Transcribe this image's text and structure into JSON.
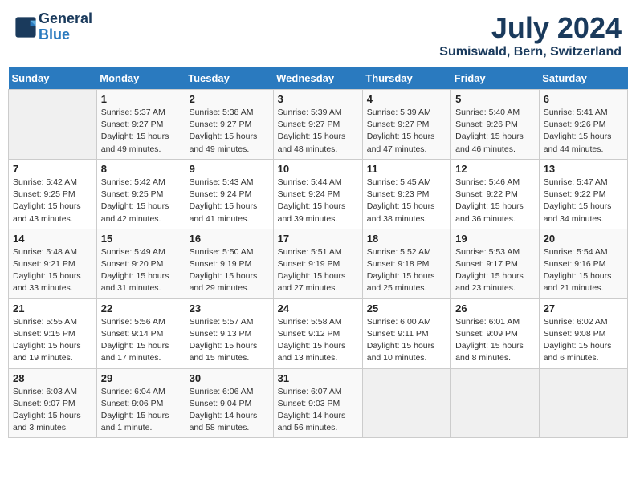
{
  "header": {
    "logo_line1": "General",
    "logo_line2": "Blue",
    "month_year": "July 2024",
    "location": "Sumiswald, Bern, Switzerland"
  },
  "days_of_week": [
    "Sunday",
    "Monday",
    "Tuesday",
    "Wednesday",
    "Thursday",
    "Friday",
    "Saturday"
  ],
  "weeks": [
    [
      {
        "day": "",
        "info": ""
      },
      {
        "day": "1",
        "info": "Sunrise: 5:37 AM\nSunset: 9:27 PM\nDaylight: 15 hours\nand 49 minutes."
      },
      {
        "day": "2",
        "info": "Sunrise: 5:38 AM\nSunset: 9:27 PM\nDaylight: 15 hours\nand 49 minutes."
      },
      {
        "day": "3",
        "info": "Sunrise: 5:39 AM\nSunset: 9:27 PM\nDaylight: 15 hours\nand 48 minutes."
      },
      {
        "day": "4",
        "info": "Sunrise: 5:39 AM\nSunset: 9:27 PM\nDaylight: 15 hours\nand 47 minutes."
      },
      {
        "day": "5",
        "info": "Sunrise: 5:40 AM\nSunset: 9:26 PM\nDaylight: 15 hours\nand 46 minutes."
      },
      {
        "day": "6",
        "info": "Sunrise: 5:41 AM\nSunset: 9:26 PM\nDaylight: 15 hours\nand 44 minutes."
      }
    ],
    [
      {
        "day": "7",
        "info": "Sunrise: 5:42 AM\nSunset: 9:25 PM\nDaylight: 15 hours\nand 43 minutes."
      },
      {
        "day": "8",
        "info": "Sunrise: 5:42 AM\nSunset: 9:25 PM\nDaylight: 15 hours\nand 42 minutes."
      },
      {
        "day": "9",
        "info": "Sunrise: 5:43 AM\nSunset: 9:24 PM\nDaylight: 15 hours\nand 41 minutes."
      },
      {
        "day": "10",
        "info": "Sunrise: 5:44 AM\nSunset: 9:24 PM\nDaylight: 15 hours\nand 39 minutes."
      },
      {
        "day": "11",
        "info": "Sunrise: 5:45 AM\nSunset: 9:23 PM\nDaylight: 15 hours\nand 38 minutes."
      },
      {
        "day": "12",
        "info": "Sunrise: 5:46 AM\nSunset: 9:22 PM\nDaylight: 15 hours\nand 36 minutes."
      },
      {
        "day": "13",
        "info": "Sunrise: 5:47 AM\nSunset: 9:22 PM\nDaylight: 15 hours\nand 34 minutes."
      }
    ],
    [
      {
        "day": "14",
        "info": "Sunrise: 5:48 AM\nSunset: 9:21 PM\nDaylight: 15 hours\nand 33 minutes."
      },
      {
        "day": "15",
        "info": "Sunrise: 5:49 AM\nSunset: 9:20 PM\nDaylight: 15 hours\nand 31 minutes."
      },
      {
        "day": "16",
        "info": "Sunrise: 5:50 AM\nSunset: 9:19 PM\nDaylight: 15 hours\nand 29 minutes."
      },
      {
        "day": "17",
        "info": "Sunrise: 5:51 AM\nSunset: 9:19 PM\nDaylight: 15 hours\nand 27 minutes."
      },
      {
        "day": "18",
        "info": "Sunrise: 5:52 AM\nSunset: 9:18 PM\nDaylight: 15 hours\nand 25 minutes."
      },
      {
        "day": "19",
        "info": "Sunrise: 5:53 AM\nSunset: 9:17 PM\nDaylight: 15 hours\nand 23 minutes."
      },
      {
        "day": "20",
        "info": "Sunrise: 5:54 AM\nSunset: 9:16 PM\nDaylight: 15 hours\nand 21 minutes."
      }
    ],
    [
      {
        "day": "21",
        "info": "Sunrise: 5:55 AM\nSunset: 9:15 PM\nDaylight: 15 hours\nand 19 minutes."
      },
      {
        "day": "22",
        "info": "Sunrise: 5:56 AM\nSunset: 9:14 PM\nDaylight: 15 hours\nand 17 minutes."
      },
      {
        "day": "23",
        "info": "Sunrise: 5:57 AM\nSunset: 9:13 PM\nDaylight: 15 hours\nand 15 minutes."
      },
      {
        "day": "24",
        "info": "Sunrise: 5:58 AM\nSunset: 9:12 PM\nDaylight: 15 hours\nand 13 minutes."
      },
      {
        "day": "25",
        "info": "Sunrise: 6:00 AM\nSunset: 9:11 PM\nDaylight: 15 hours\nand 10 minutes."
      },
      {
        "day": "26",
        "info": "Sunrise: 6:01 AM\nSunset: 9:09 PM\nDaylight: 15 hours\nand 8 minutes."
      },
      {
        "day": "27",
        "info": "Sunrise: 6:02 AM\nSunset: 9:08 PM\nDaylight: 15 hours\nand 6 minutes."
      }
    ],
    [
      {
        "day": "28",
        "info": "Sunrise: 6:03 AM\nSunset: 9:07 PM\nDaylight: 15 hours\nand 3 minutes."
      },
      {
        "day": "29",
        "info": "Sunrise: 6:04 AM\nSunset: 9:06 PM\nDaylight: 15 hours\nand 1 minute."
      },
      {
        "day": "30",
        "info": "Sunrise: 6:06 AM\nSunset: 9:04 PM\nDaylight: 14 hours\nand 58 minutes."
      },
      {
        "day": "31",
        "info": "Sunrise: 6:07 AM\nSunset: 9:03 PM\nDaylight: 14 hours\nand 56 minutes."
      },
      {
        "day": "",
        "info": ""
      },
      {
        "day": "",
        "info": ""
      },
      {
        "day": "",
        "info": ""
      }
    ]
  ]
}
